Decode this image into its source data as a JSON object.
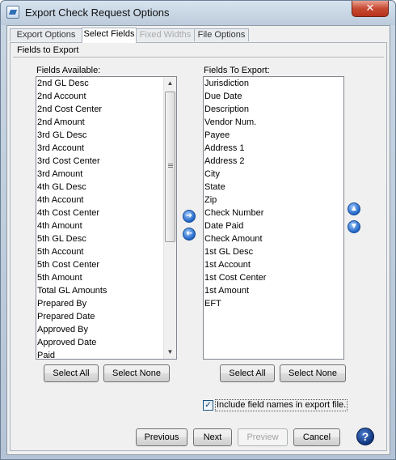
{
  "window": {
    "title": "Export Check Request Options",
    "close_glyph": "✕"
  },
  "tabs": [
    {
      "label": "Export Options",
      "state": "normal"
    },
    {
      "label": "Select Fields",
      "state": "active"
    },
    {
      "label": "Fixed Widths",
      "state": "disabled"
    },
    {
      "label": "File Options",
      "state": "normal"
    }
  ],
  "section_title": "Fields to Export",
  "available": {
    "label": "Fields Available:",
    "items": [
      "2nd GL Desc",
      "2nd Account",
      "2nd Cost Center",
      "2nd Amount",
      "3rd GL Desc",
      "3rd Account",
      "3rd Cost Center",
      "3rd Amount",
      "4th GL Desc",
      "4th Account",
      "4th Cost Center",
      "4th Amount",
      "5th GL Desc",
      "5th Account",
      "5th Cost Center",
      "5th Amount",
      "Total GL Amounts",
      "Prepared By",
      "Prepared Date",
      "Approved By",
      "Approved Date",
      "Paid"
    ],
    "select_all": "Select All",
    "select_none": "Select None"
  },
  "export": {
    "label": "Fields To Export:",
    "items": [
      "Jurisdiction",
      "Due Date",
      "Description",
      "Vendor Num.",
      "Payee",
      "Address 1",
      "Address 2",
      "City",
      "State",
      "Zip",
      "Check Number",
      "Date Paid",
      "Check Amount",
      "1st GL Desc",
      "1st Account",
      "1st Cost Center",
      "1st Amount",
      "EFT"
    ],
    "select_all": "Select All",
    "select_none": "Select None"
  },
  "move": {
    "add_icon": "arrow-right-icon",
    "remove_icon": "arrow-left-icon",
    "up_icon": "arrow-up-icon",
    "down_icon": "arrow-down-icon"
  },
  "include_names": {
    "label": "Include field names in export file.",
    "checked": true
  },
  "footer": {
    "previous": "Previous",
    "next": "Next",
    "preview": "Preview",
    "cancel": "Cancel",
    "help": "?"
  },
  "colors": {
    "accent": "#1f63c4",
    "close": "#c74a33"
  }
}
